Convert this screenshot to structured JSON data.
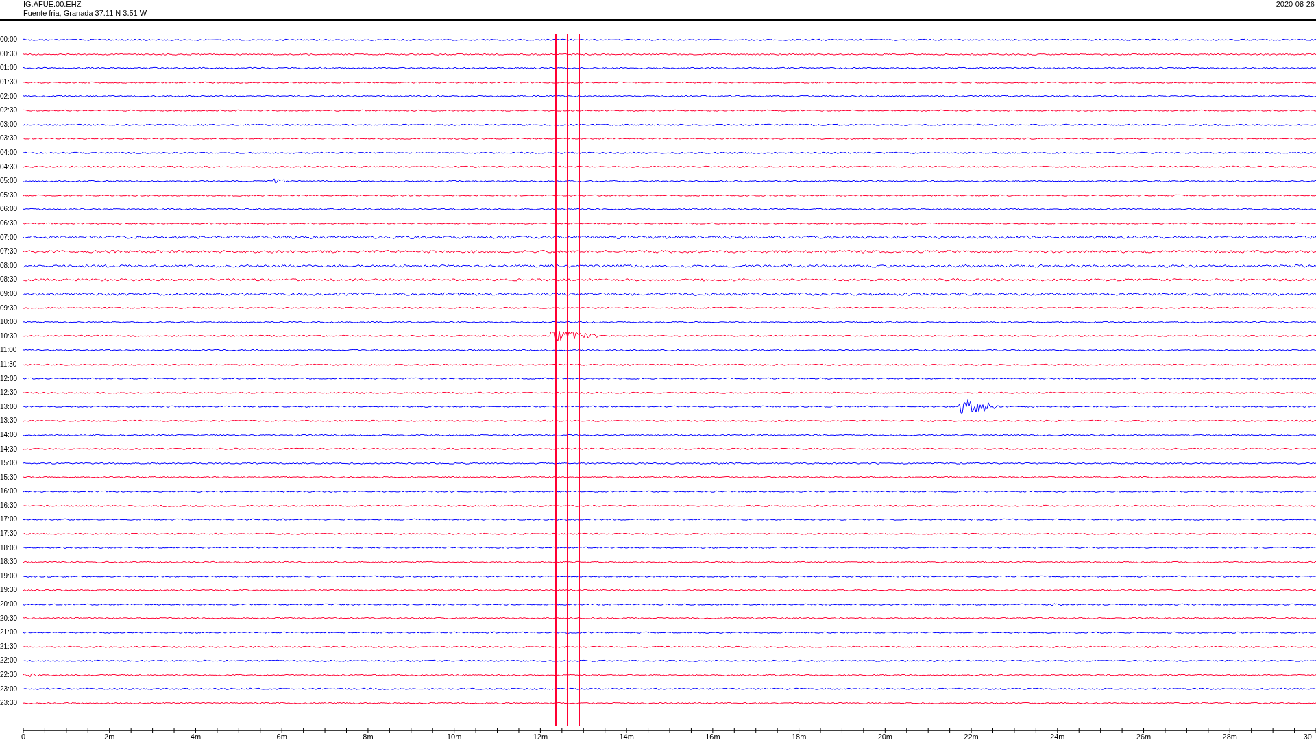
{
  "header": {
    "station": "IG.AFUE.00.EHZ",
    "location": "Fuente fria, Granada  37.11 N 3.51 W",
    "date": "2020-08-26"
  },
  "rows": [
    {
      "label": "00:00",
      "color": "#0000ff"
    },
    {
      "label": "00:30",
      "color": "#ff0033"
    },
    {
      "label": "01:00",
      "color": "#0000ff"
    },
    {
      "label": "01:30",
      "color": "#ff0033"
    },
    {
      "label": "02:00",
      "color": "#0000ff"
    },
    {
      "label": "02:30",
      "color": "#ff0033"
    },
    {
      "label": "03:00",
      "color": "#0000ff"
    },
    {
      "label": "03:30",
      "color": "#ff0033"
    },
    {
      "label": "04:00",
      "color": "#0000ff"
    },
    {
      "label": "04:30",
      "color": "#ff0033"
    },
    {
      "label": "05:00",
      "color": "#0000ff"
    },
    {
      "label": "05:30",
      "color": "#ff0033"
    },
    {
      "label": "06:00",
      "color": "#0000ff"
    },
    {
      "label": "06:30",
      "color": "#ff0033"
    },
    {
      "label": "07:00",
      "color": "#0000ff"
    },
    {
      "label": "07:30",
      "color": "#ff0033"
    },
    {
      "label": "08:00",
      "color": "#0000ff"
    },
    {
      "label": "08:30",
      "color": "#ff0033"
    },
    {
      "label": "09:00",
      "color": "#0000ff"
    },
    {
      "label": "09:30",
      "color": "#ff0033"
    },
    {
      "label": "10:00",
      "color": "#0000ff"
    },
    {
      "label": "10:30",
      "color": "#ff0033"
    },
    {
      "label": "11:00",
      "color": "#0000ff"
    },
    {
      "label": "11:30",
      "color": "#ff0033"
    },
    {
      "label": "12:00",
      "color": "#0000ff"
    },
    {
      "label": "12:30",
      "color": "#ff0033"
    },
    {
      "label": "13:00",
      "color": "#0000ff"
    },
    {
      "label": "13:30",
      "color": "#ff0033"
    },
    {
      "label": "14:00",
      "color": "#0000ff"
    },
    {
      "label": "14:30",
      "color": "#ff0033"
    },
    {
      "label": "15:00",
      "color": "#0000ff"
    },
    {
      "label": "15:30",
      "color": "#ff0033"
    },
    {
      "label": "16:00",
      "color": "#0000ff"
    },
    {
      "label": "16:30",
      "color": "#ff0033"
    },
    {
      "label": "17:00",
      "color": "#0000ff"
    },
    {
      "label": "17:30",
      "color": "#ff0033"
    },
    {
      "label": "18:00",
      "color": "#0000ff"
    },
    {
      "label": "18:30",
      "color": "#ff0033"
    },
    {
      "label": "19:00",
      "color": "#0000ff"
    },
    {
      "label": "19:30",
      "color": "#ff0033"
    },
    {
      "label": "20:00",
      "color": "#0000ff"
    },
    {
      "label": "20:30",
      "color": "#ff0033"
    },
    {
      "label": "21:00",
      "color": "#0000ff"
    },
    {
      "label": "21:30",
      "color": "#ff0033"
    },
    {
      "label": "22:00",
      "color": "#0000ff"
    },
    {
      "label": "22:30",
      "color": "#ff0033"
    },
    {
      "label": "23:00",
      "color": "#0000ff"
    },
    {
      "label": "23:30",
      "color": "#ff0033"
    }
  ],
  "x_axis": {
    "tick_labels": [
      "0",
      "2m",
      "4m",
      "6m",
      "8m",
      "10m",
      "12m",
      "14m",
      "16m",
      "18m",
      "20m",
      "22m",
      "24m",
      "26m",
      "28m",
      "30"
    ]
  }
}
